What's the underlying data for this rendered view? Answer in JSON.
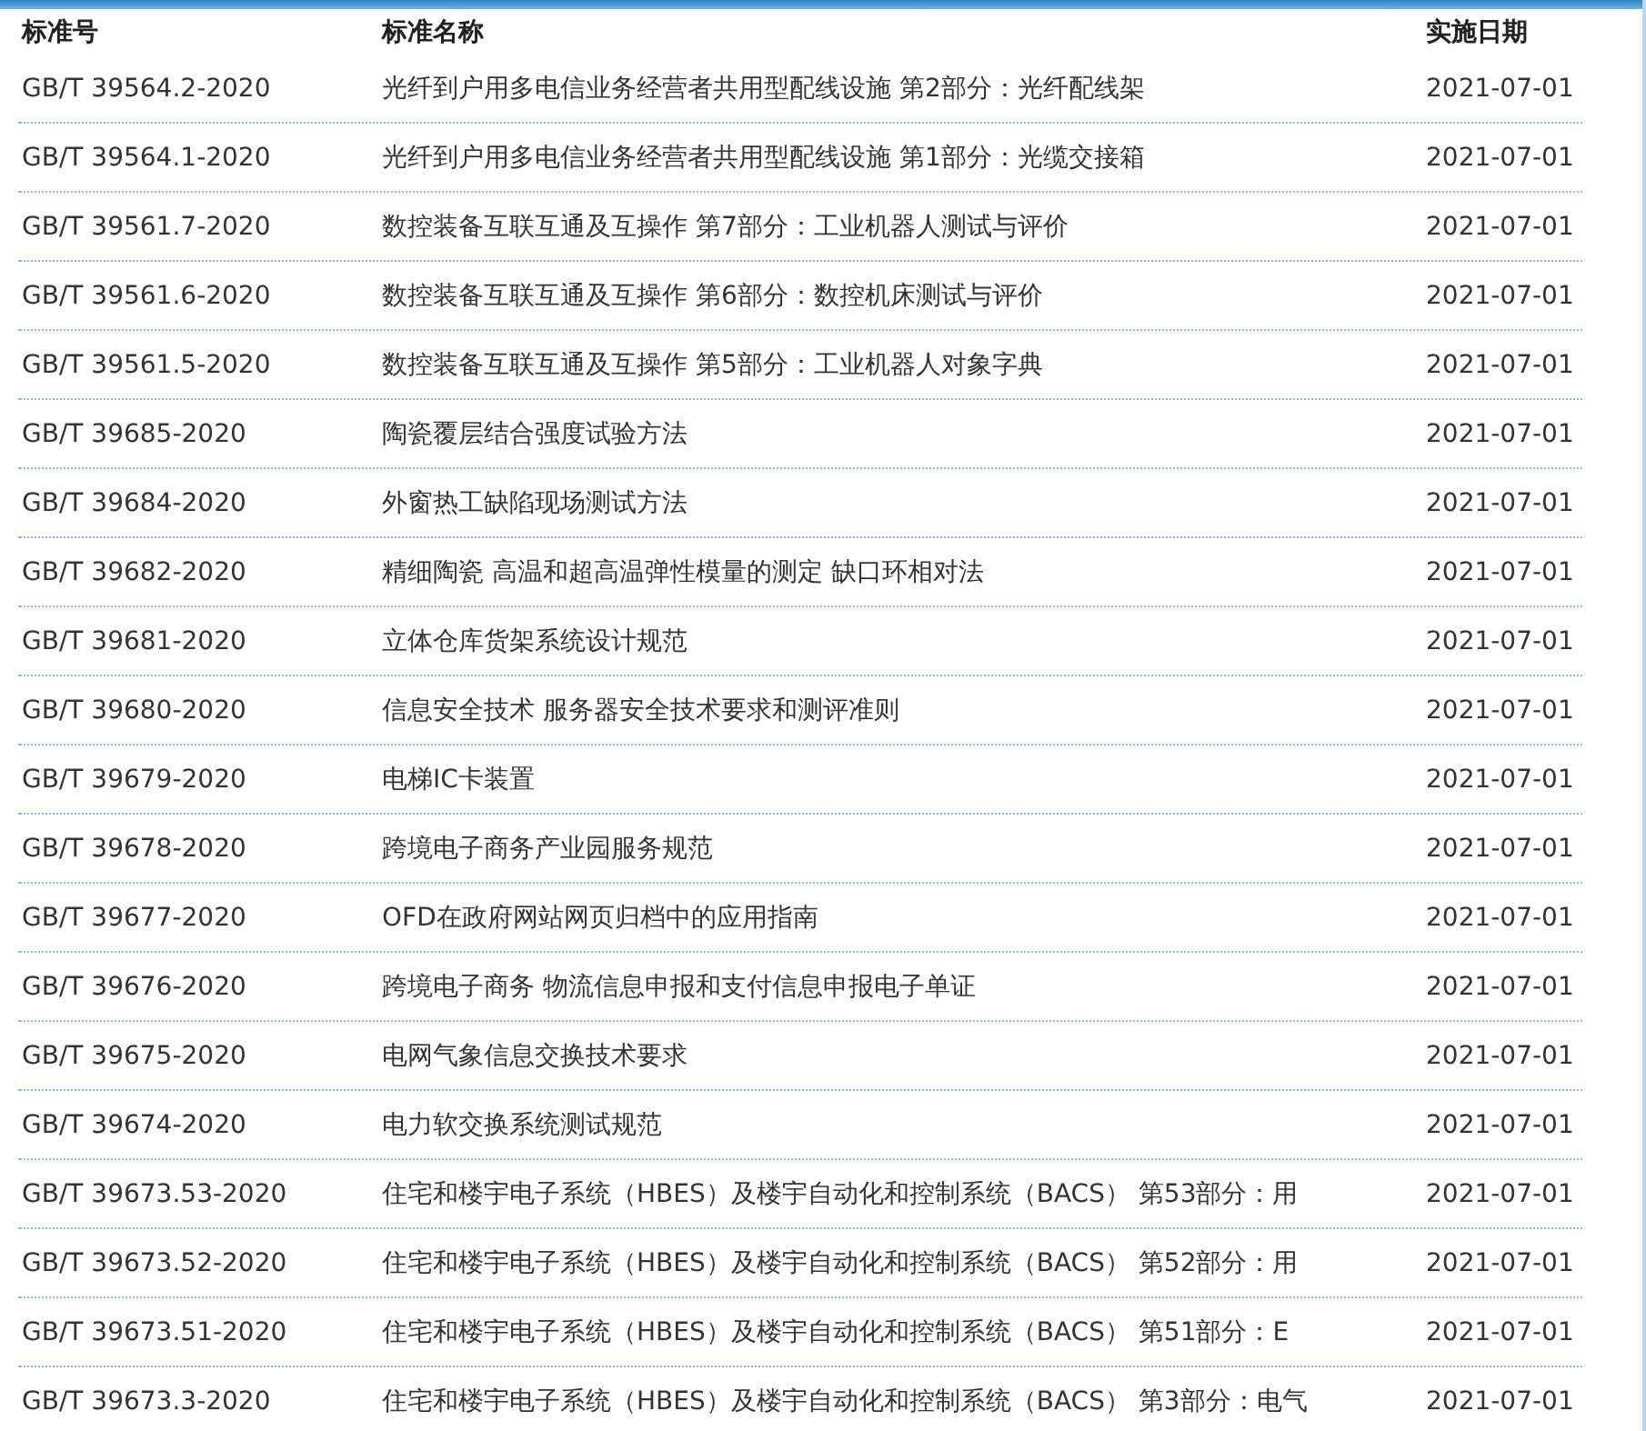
{
  "table": {
    "columns": [
      "标准号",
      "标准名称",
      "实施日期"
    ],
    "rows": [
      {
        "code": "GB/T 39564.2-2020",
        "name": "光纤到户用多电信业务经营者共用型配线设施 第2部分：光纤配线架",
        "date": "2021-07-01"
      },
      {
        "code": "GB/T 39564.1-2020",
        "name": "光纤到户用多电信业务经营者共用型配线设施 第1部分：光缆交接箱",
        "date": "2021-07-01"
      },
      {
        "code": "GB/T 39561.7-2020",
        "name": "数控装备互联互通及互操作 第7部分：工业机器人测试与评价",
        "date": "2021-07-01"
      },
      {
        "code": "GB/T 39561.6-2020",
        "name": "数控装备互联互通及互操作 第6部分：数控机床测试与评价",
        "date": "2021-07-01"
      },
      {
        "code": "GB/T 39561.5-2020",
        "name": "数控装备互联互通及互操作 第5部分：工业机器人对象字典",
        "date": "2021-07-01"
      },
      {
        "code": "GB/T 39685-2020",
        "name": "陶瓷覆层结合强度试验方法",
        "date": "2021-07-01"
      },
      {
        "code": "GB/T 39684-2020",
        "name": "外窗热工缺陷现场测试方法",
        "date": "2021-07-01"
      },
      {
        "code": "GB/T 39682-2020",
        "name": "精细陶瓷 高温和超高温弹性模量的测定 缺口环相对法",
        "date": "2021-07-01"
      },
      {
        "code": "GB/T 39681-2020",
        "name": "立体仓库货架系统设计规范",
        "date": "2021-07-01"
      },
      {
        "code": "GB/T 39680-2020",
        "name": "信息安全技术 服务器安全技术要求和测评准则",
        "date": "2021-07-01"
      },
      {
        "code": "GB/T 39679-2020",
        "name": "电梯IC卡装置",
        "date": "2021-07-01"
      },
      {
        "code": "GB/T 39678-2020",
        "name": "跨境电子商务产业园服务规范",
        "date": "2021-07-01"
      },
      {
        "code": "GB/T 39677-2020",
        "name": "OFD在政府网站网页归档中的应用指南",
        "date": "2021-07-01"
      },
      {
        "code": "GB/T 39676-2020",
        "name": "跨境电子商务 物流信息申报和支付信息申报电子单证",
        "date": "2021-07-01"
      },
      {
        "code": "GB/T 39675-2020",
        "name": "电网气象信息交换技术要求",
        "date": "2021-07-01"
      },
      {
        "code": "GB/T 39674-2020",
        "name": "电力软交换系统测试规范",
        "date": "2021-07-01"
      },
      {
        "code": "GB/T 39673.53-2020",
        "name": "住宅和楼宇电子系统（HBES）及楼宇自动化和控制系统（BACS） 第53部分：用",
        "date": "2021-07-01"
      },
      {
        "code": "GB/T 39673.52-2020",
        "name": "住宅和楼宇电子系统（HBES）及楼宇自动化和控制系统（BACS） 第52部分：用",
        "date": "2021-07-01"
      },
      {
        "code": "GB/T 39673.51-2020",
        "name": "住宅和楼宇电子系统（HBES）及楼宇自动化和控制系统（BACS） 第51部分：E",
        "date": "2021-07-01"
      },
      {
        "code": "GB/T 39673.3-2020",
        "name": "住宅和楼宇电子系统（HBES）及楼宇自动化和控制系统（BACS） 第3部分：电气",
        "date": "2021-07-01"
      }
    ]
  }
}
